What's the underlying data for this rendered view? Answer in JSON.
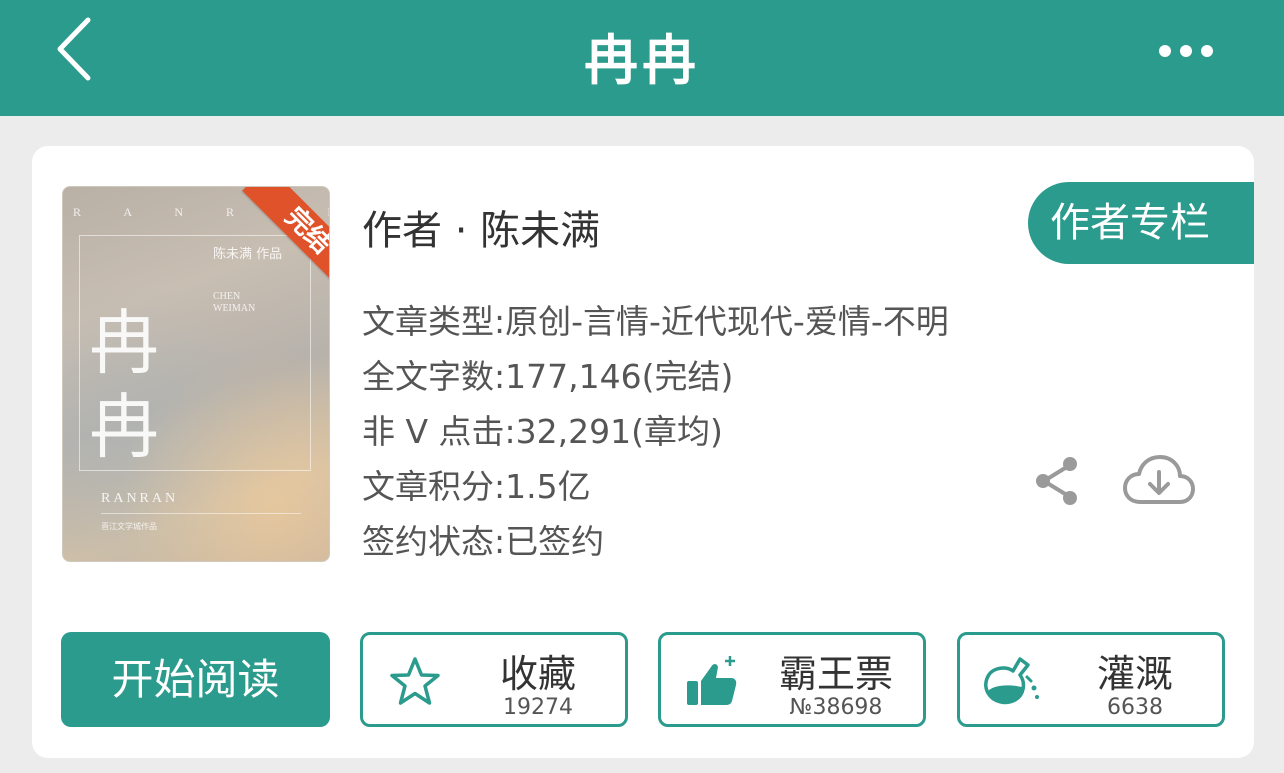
{
  "header": {
    "title": "冉冉",
    "back_icon": "chevron-left-icon",
    "more_icon": "more-horizontal-icon"
  },
  "book": {
    "cover": {
      "spine_text": "R A N R A N",
      "title_chars": "冉冉",
      "author_zh": "陈未满 作品",
      "author_en": "CHEN WEIMAN",
      "bottom_en": "RANRAN",
      "bottom_small": "晋江文学城作品",
      "ribbon": "完结"
    },
    "author_line": "作者 · 陈未满",
    "author_column_label": "作者专栏",
    "info": [
      "文章类型:原创-言情-近代现代-爱情-不明",
      "全文字数:177,146(完结)",
      "非 V 点击:32,291(章均)",
      "文章积分:1.5亿",
      "签约状态:已签约"
    ],
    "share_icon": "share-icon",
    "download_icon": "cloud-download-icon"
  },
  "actions": {
    "start_reading": "开始阅读",
    "favorite": {
      "label": "收藏",
      "count": "19274",
      "icon": "star-icon"
    },
    "overlord": {
      "label": "霸王票",
      "count": "№38698",
      "icon": "thumbs-up-icon"
    },
    "water": {
      "label": "灌溉",
      "count": "6638",
      "icon": "watering-flask-icon"
    }
  },
  "colors": {
    "primary": "#2a9b8c",
    "ribbon": "#e0532a",
    "background": "#ececec"
  }
}
